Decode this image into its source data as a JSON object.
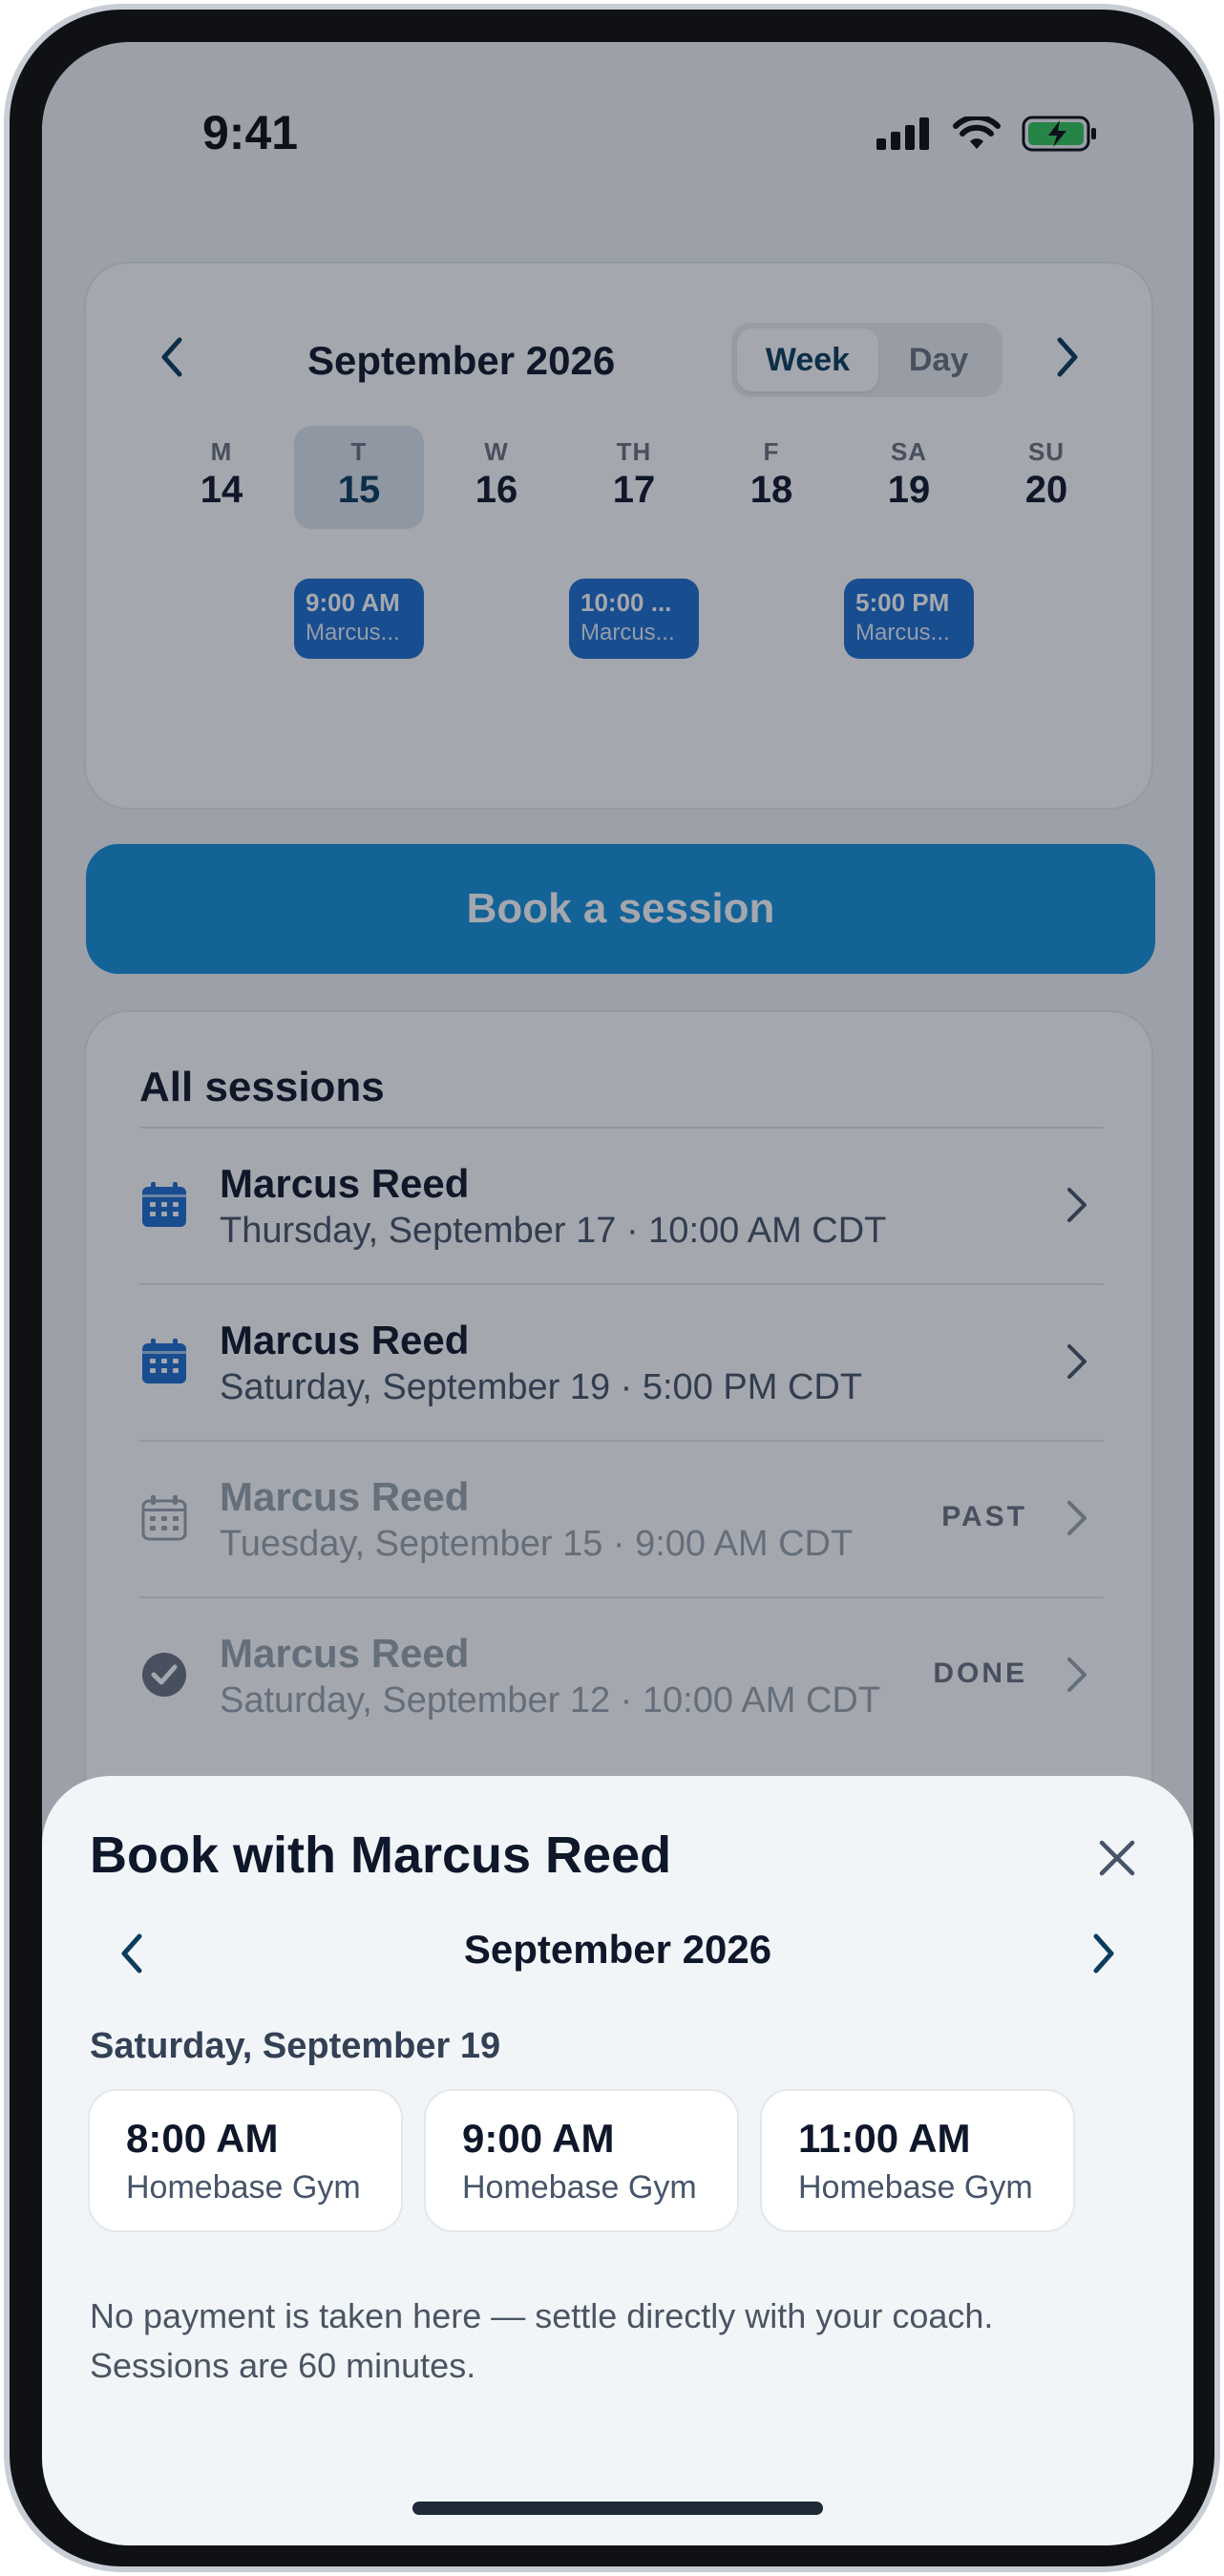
{
  "status_bar": {
    "time": "9:41"
  },
  "calendar": {
    "month": "September 2026",
    "view_toggle": {
      "week": "Week",
      "day": "Day",
      "selected": "Week"
    },
    "days": [
      {
        "dow": "M",
        "num": "14"
      },
      {
        "dow": "T",
        "num": "15",
        "selected": true
      },
      {
        "dow": "W",
        "num": "16"
      },
      {
        "dow": "TH",
        "num": "17"
      },
      {
        "dow": "F",
        "num": "18"
      },
      {
        "dow": "SA",
        "num": "19"
      },
      {
        "dow": "SU",
        "num": "20"
      }
    ],
    "events": [
      {
        "day": "15",
        "time": "9:00 AM",
        "name": "Marcus..."
      },
      {
        "day": "17",
        "time": "10:00 ...",
        "name": "Marcus..."
      },
      {
        "day": "19",
        "time": "5:00 PM",
        "name": "Marcus..."
      }
    ]
  },
  "book_button": {
    "label": "Book a session"
  },
  "sessions": {
    "title": "All sessions",
    "items": [
      {
        "name": "Marcus Reed",
        "when": "Thursday, September 17 · 10:00 AM CDT",
        "badge": "",
        "state": "upcoming",
        "icon": "calendar-icon"
      },
      {
        "name": "Marcus Reed",
        "when": "Saturday, September 19 · 5:00 PM CDT",
        "badge": "",
        "state": "upcoming",
        "icon": "calendar-icon"
      },
      {
        "name": "Marcus Reed",
        "when": "Tuesday, September 15 · 9:00 AM CDT",
        "badge": "PAST",
        "state": "past",
        "icon": "calendar-icon"
      },
      {
        "name": "Marcus Reed",
        "when": "Saturday, September 12 · 10:00 AM CDT",
        "badge": "DONE",
        "state": "done",
        "icon": "check-circle-icon"
      }
    ]
  },
  "sheet": {
    "title": "Book with Marcus Reed",
    "month": "September 2026",
    "date_heading": "Saturday, September 19",
    "slots": [
      {
        "time": "8:00 AM",
        "location": "Homebase Gym"
      },
      {
        "time": "9:00 AM",
        "location": "Homebase Gym"
      },
      {
        "time": "11:00 AM",
        "location": "Homebase Gym"
      }
    ],
    "note_line1": "No payment is taken here — settle directly with your coach.",
    "note_line2": "Sessions are 60 minutes."
  },
  "colors": {
    "accent": "#1692dc",
    "event_chip": "#1d6fd1",
    "sheet_bg": "#f2f5f8",
    "dim_overlay": "rgba(17,24,39,0.38)"
  }
}
